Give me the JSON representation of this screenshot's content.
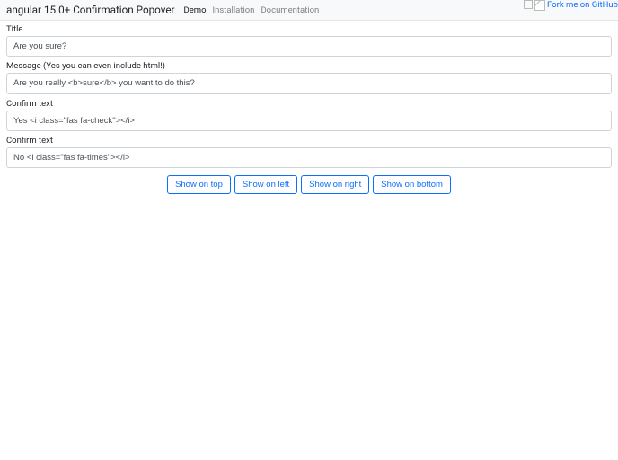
{
  "navbar": {
    "brand": "angular 15.0+ Confirmation Popover",
    "items": [
      {
        "label": "Demo",
        "active": true
      },
      {
        "label": "Installation",
        "active": false
      },
      {
        "label": "Documentation",
        "active": false
      }
    ],
    "fork_alt": "Fork me on GitHub"
  },
  "form": {
    "title_label": "Title",
    "title_value": "Are you sure?",
    "message_label": "Message (Yes you can even include html!)",
    "message_value": "Are you really <b>sure</b> you want to do this?",
    "confirm_label": "Confirm text",
    "confirm_value": "Yes <i class=\"fas fa-check\"></i>",
    "cancel_label": "Confirm text",
    "cancel_value": "No <i class=\"fas fa-times\"></i>"
  },
  "buttons": {
    "top": "Show on top",
    "left": "Show on left",
    "right": "Show on right",
    "bottom": "Show on bottom"
  }
}
